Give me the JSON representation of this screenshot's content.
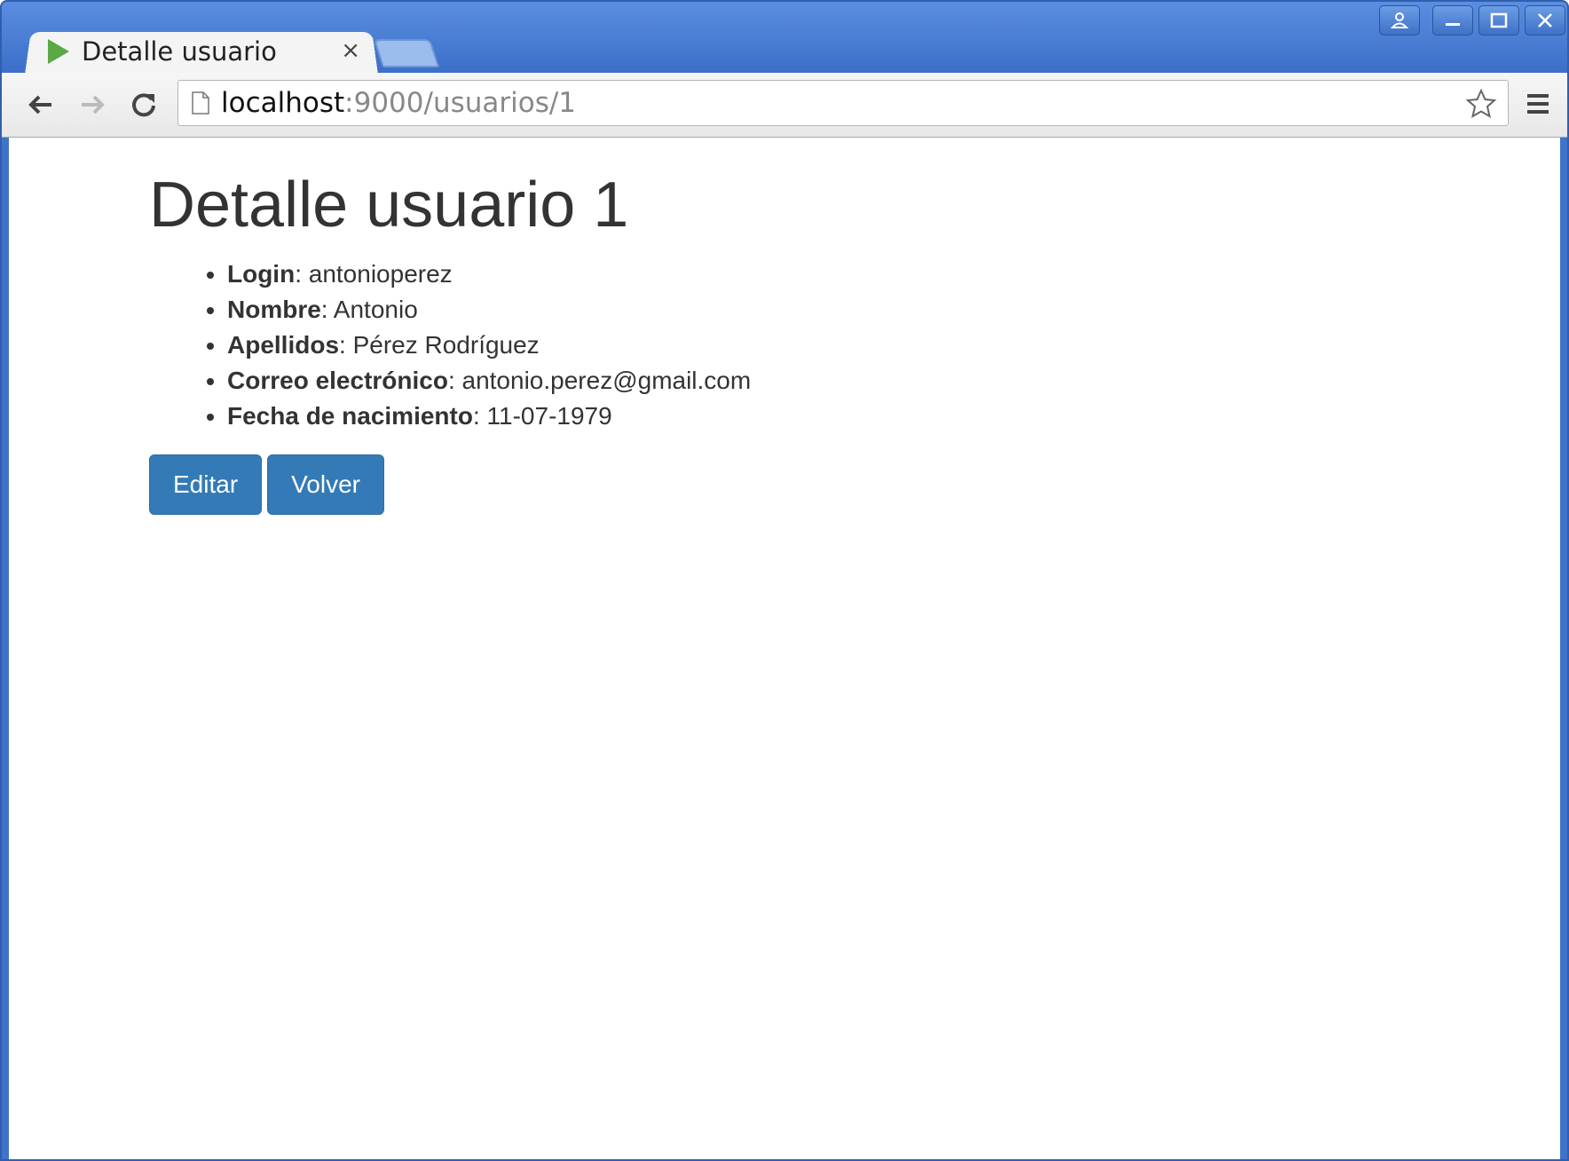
{
  "browser": {
    "tab_title": "Detalle usuario",
    "tab_close": "×",
    "url_host": "localhost",
    "url_rest": ":9000/usuarios/1"
  },
  "page": {
    "heading": "Detalle usuario 1",
    "fields": [
      {
        "label": "Login",
        "value": ": antonioperez"
      },
      {
        "label": "Nombre",
        "value": ": Antonio"
      },
      {
        "label": "Apellidos",
        "value": ": Pérez Rodríguez"
      },
      {
        "label": "Correo electrónico",
        "value": ": antonio.perez@gmail.com"
      },
      {
        "label": "Fecha de nacimiento",
        "value": ": 11-07-1979"
      }
    ],
    "buttons": {
      "edit_label": "Editar",
      "back_label": "Volver"
    }
  },
  "colors": {
    "primary_button": "#337ab7",
    "window_frame": "#3f73c9",
    "favicon": "#5aa846"
  }
}
